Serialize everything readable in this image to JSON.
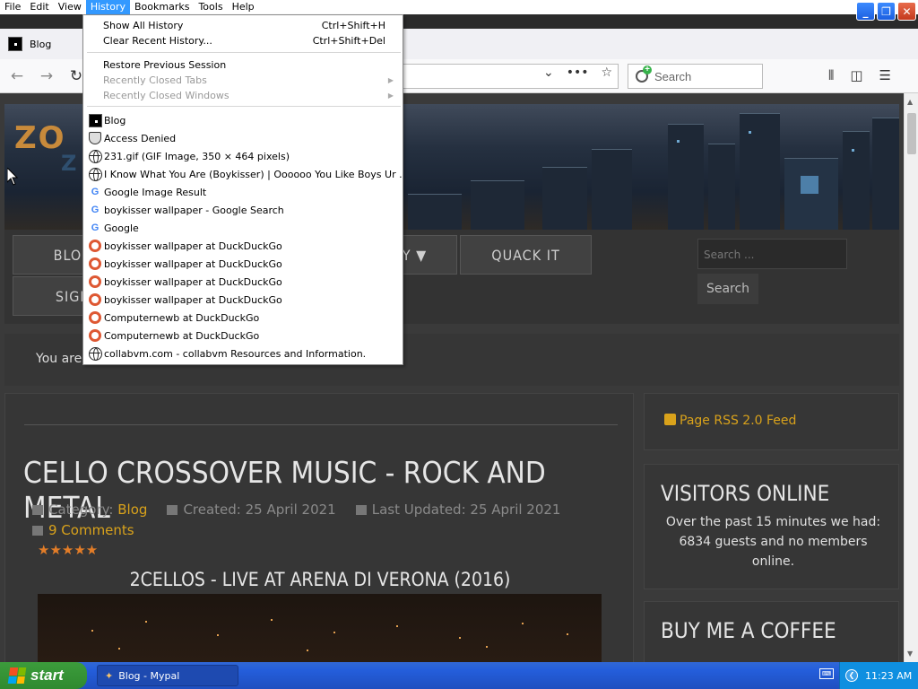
{
  "menubar": {
    "items": [
      "File",
      "Edit",
      "View",
      "History",
      "Bookmarks",
      "Tools",
      "Help"
    ]
  },
  "window_controls": {
    "minimize_icon": "minimize-icon",
    "restore_icon": "restore-icon",
    "close_icon": "close-icon"
  },
  "tab": {
    "title": "Blog"
  },
  "toolbar": {
    "search_placeholder": "Search",
    "url_more": "•••"
  },
  "history_menu": {
    "show_all": {
      "label": "Show All History",
      "shortcut": "Ctrl+Shift+H"
    },
    "clear_recent": {
      "label": "Clear Recent History...",
      "shortcut": "Ctrl+Shift+Del"
    },
    "restore_session": "Restore Previous Session",
    "recently_closed_tabs": "Recently Closed Tabs",
    "recently_closed_windows": "Recently Closed Windows",
    "entries": [
      {
        "icon": "blog-favicon",
        "label": "Blog"
      },
      {
        "icon": "shield-icon",
        "label": "Access Denied"
      },
      {
        "icon": "globe-icon",
        "label": "231.gif (GIF Image, 350 × 464 pixels)"
      },
      {
        "icon": "globe-icon",
        "label": "I Know What You Are (Boykisser) | Oooooo You Like Boys Ur ..."
      },
      {
        "icon": "google-icon",
        "label": "Google Image Result"
      },
      {
        "icon": "google-icon",
        "label": "boykisser wallpaper - Google Search"
      },
      {
        "icon": "google-icon",
        "label": "Google"
      },
      {
        "icon": "duckduckgo-icon",
        "label": "boykisser wallpaper at DuckDuckGo"
      },
      {
        "icon": "duckduckgo-icon",
        "label": "boykisser wallpaper at DuckDuckGo"
      },
      {
        "icon": "duckduckgo-icon",
        "label": "boykisser wallpaper at DuckDuckGo"
      },
      {
        "icon": "duckduckgo-icon",
        "label": "boykisser wallpaper at DuckDuckGo"
      },
      {
        "icon": "duckduckgo-icon",
        "label": "Computernewb at DuckDuckGo"
      },
      {
        "icon": "duckduckgo-icon",
        "label": "Computernewb at DuckDuckGo"
      },
      {
        "icon": "globe-icon",
        "label": "collabvm.com - collabvm Resources and Information."
      }
    ]
  },
  "site": {
    "logo_text": "ZO",
    "logo_text2": "Z",
    "nav": {
      "blog": "BLOG",
      "gallery": "ERY",
      "quack_it": "QUACK IT",
      "sign": "SIGN"
    },
    "search_placeholder": "Search ...",
    "search_button": "Search",
    "breadcrumb": "You are",
    "article": {
      "title": "CELLO CROSSOVER MUSIC - ROCK AND METAL",
      "category_label": "Category:",
      "category_value": "Blog",
      "created": "Created: 25 April 2021",
      "updated": "Last Updated: 25 April 2021",
      "comments": "9 Comments",
      "rating_stars": "★★★★★",
      "subtitle": "2CELLOS - LIVE AT ARENA DI VERONA (2016)"
    },
    "sidebar": {
      "rss": "Page RSS 2.0 Feed",
      "visitors_title": "VISITORS ONLINE",
      "visitors_text": "Over the past 15 minutes we had: 6834 guests and no members online.",
      "coffee_title": "BUY ME A COFFEE"
    }
  },
  "taskbar": {
    "start": "start",
    "task": "Blog - Mypal",
    "clock": "11:23 AM"
  },
  "colors": {
    "accent_gold": "#d9a21b",
    "star_orange": "#e37d28",
    "menu_highlight": "#3399ff",
    "xp_blue": "#245edb"
  }
}
